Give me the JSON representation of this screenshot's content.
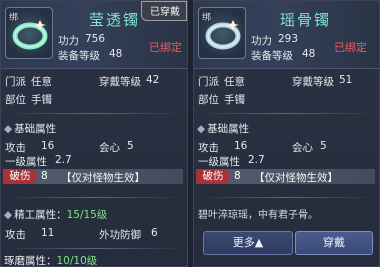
{
  "left": {
    "bind_tag": "绑",
    "equipped_badge": "已穿戴",
    "name": "莹透镯",
    "power_label": "功力",
    "power_value": "756",
    "level_label": "装备等级",
    "level_value": "48",
    "bound_status": "已绑定",
    "sect_label": "门派",
    "sect_value": "任意",
    "wear_level_label": "穿戴等级",
    "wear_level_value": "42",
    "slot_label": "部位",
    "slot_value": "手镯",
    "base_attr_title": "基础属性",
    "attack_label": "攻击",
    "attack_value": "16",
    "crit_label": "会心",
    "crit_value": "5",
    "primary_label": "一级属性",
    "primary_value": "2.7",
    "pierce_label": "破伤",
    "pierce_value": "8",
    "pierce_note": "【仅对怪物生效】",
    "refine_title": "精工属性：",
    "refine_value": "15/15级",
    "refine_attack_label": "攻击",
    "refine_attack_value": "11",
    "refine_defense_label": "外功防御",
    "refine_defense_value": "6",
    "polish_title": "琢磨属性：",
    "polish_value": "10/10级"
  },
  "right": {
    "bind_tag": "绑",
    "name": "瑶骨镯",
    "power_label": "功力",
    "power_value": "293",
    "level_label": "装备等级",
    "level_value": "48",
    "bound_status": "已绑定",
    "sect_label": "门派",
    "sect_value": "任意",
    "wear_level_label": "穿戴等级",
    "wear_level_value": "51",
    "slot_label": "部位",
    "slot_value": "手镯",
    "base_attr_title": "基础属性",
    "attack_label": "攻击",
    "attack_value": "16",
    "crit_label": "会心",
    "crit_value": "5",
    "primary_label": "一级属性",
    "primary_value": "2.7",
    "pierce_label": "破伤",
    "pierce_value": "8",
    "pierce_note": "【仅对怪物生效】",
    "flavor": "碧叶淬琼瑶，中有君子骨。",
    "more_button": "更多▲",
    "wear_button": "穿戴"
  },
  "colors": {
    "name": "#7fe5ce",
    "bound": "#e46060",
    "green": "#7fe383",
    "pierce_tag": "#a8323b"
  },
  "icons": {
    "item": "bracelet-icon",
    "spark": "sparkle-icon"
  }
}
